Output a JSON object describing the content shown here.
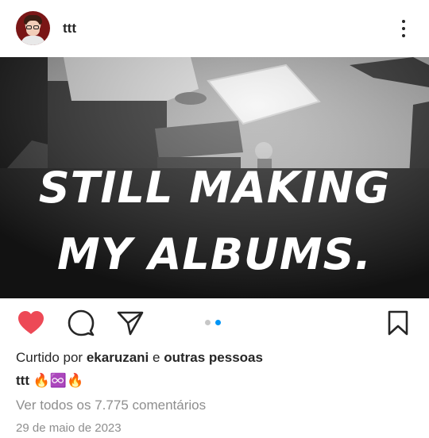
{
  "post": {
    "username": "ttt",
    "image_text_line1": "STILL MAKING",
    "image_text_line2": "MY ALBUMS.",
    "carousel": {
      "count": 2,
      "active": 2
    },
    "liked": true,
    "liked_by_prefix": "Curtido por",
    "liked_by_user": "ekaruzani",
    "liked_by_joiner": "e",
    "liked_by_others": "outras pessoas",
    "caption_user": "ttt",
    "caption_text": "🔥♾️🔥",
    "view_comments": "Ver todos os 7.775 comentários",
    "date": "29 de maio de 2023"
  },
  "colors": {
    "like_red": "#ed4956",
    "carousel_active": "#0095f6",
    "carousel_inactive": "#c7c7c7",
    "muted_text": "#8e8e8e"
  },
  "icons": {
    "more": "more-vertical-icon",
    "like": "heart-filled-icon",
    "comment": "comment-bubble-icon",
    "share": "paper-plane-icon",
    "save": "bookmark-icon"
  }
}
